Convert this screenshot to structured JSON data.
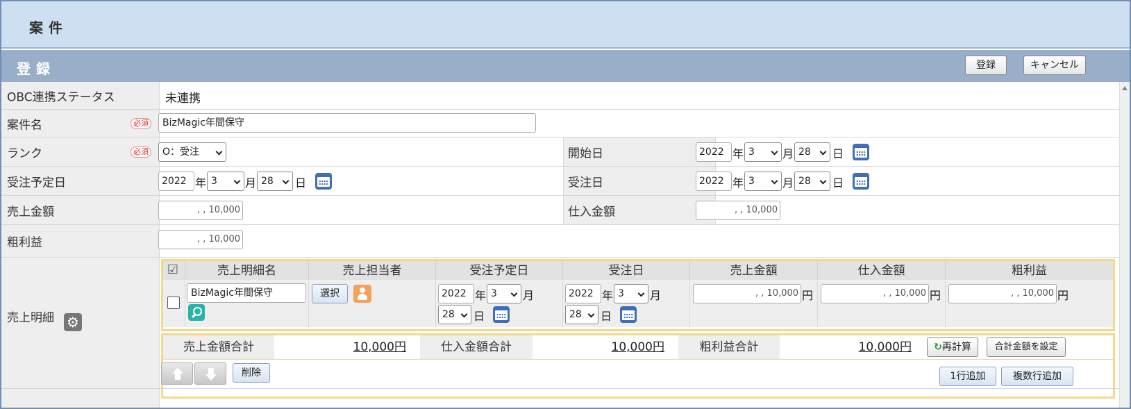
{
  "header": {
    "title": "案件"
  },
  "section": {
    "title": "登録",
    "register_label": "登録",
    "cancel_label": "キャンセル"
  },
  "form": {
    "obc": {
      "label": "OBC連携ステータス",
      "value": "未連携"
    },
    "name": {
      "label": "案件名",
      "required": "必須",
      "value": "BizMagic年間保守"
    },
    "rank": {
      "label": "ランク",
      "required": "必須",
      "value": "O：受注"
    },
    "start_date": {
      "label": "開始日",
      "year": "2022",
      "month": "3",
      "day": "28"
    },
    "planned_order_date": {
      "label": "受注予定日",
      "year": "2022",
      "month": "3",
      "day": "28"
    },
    "order_date": {
      "label": "受注日",
      "year": "2022",
      "month": "3",
      "day": "28"
    },
    "sales_amount": {
      "label": "売上金額",
      "value": ",   ,  10,000"
    },
    "purchase_amount": {
      "label": "仕入金額",
      "value": ",   ,  10,000"
    },
    "gross_profit": {
      "label": "粗利益",
      "value": ",   ,  10,000"
    },
    "units": {
      "year": "年",
      "month": "月",
      "day": "日",
      "yen": "円"
    }
  },
  "details": {
    "label": "売上明細",
    "headers": [
      "売上明細名",
      "売上担当者",
      "受注予定日",
      "受注日",
      "売上金額",
      "仕入金額",
      "粗利益"
    ],
    "row": {
      "name": "BizMagic年間保守",
      "select_label": "選択",
      "planned": {
        "year": "2022",
        "month": "3",
        "day": "28"
      },
      "ordered": {
        "year": "2022",
        "month": "3",
        "day": "28"
      },
      "sales": ",   ,  10,000",
      "purchase": ",   ,  10,000",
      "profit": ",   ,  10,000"
    },
    "totals": {
      "sales_label": "売上金額合計",
      "sales_value": "10,000円",
      "purchase_label": "仕入金額合計",
      "purchase_value": "10,000円",
      "profit_label": "粗利益合計",
      "profit_value": "10,000円",
      "recalc_label": "再計算",
      "set_total_label": "合計金額を設定"
    },
    "actions": {
      "delete_label": "削除",
      "add_row_label": "1行追加",
      "add_rows_label": "複数行追加"
    }
  }
}
